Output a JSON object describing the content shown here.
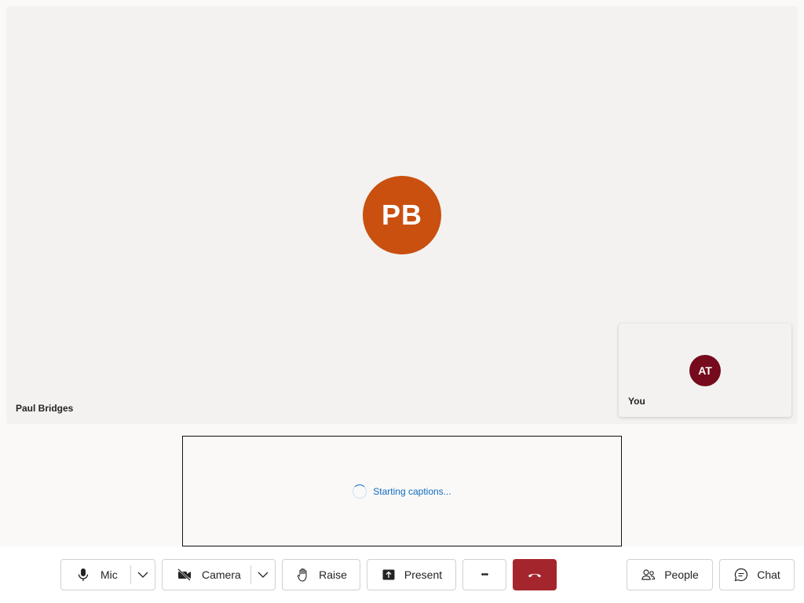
{
  "stage": {
    "main_participant": {
      "initials": "PB",
      "name": "Paul Bridges",
      "avatar_color": "#ca5010"
    },
    "self_view": {
      "initials": "AT",
      "label": "You",
      "avatar_color": "#750b1c"
    }
  },
  "captions": {
    "status": "Starting captions..."
  },
  "toolbar": {
    "mic_label": "Mic",
    "camera_label": "Camera",
    "raise_label": "Raise",
    "present_label": "Present",
    "more_label": "•••",
    "leave_color": "#a4262c",
    "people_label": "People",
    "chat_label": "Chat"
  }
}
